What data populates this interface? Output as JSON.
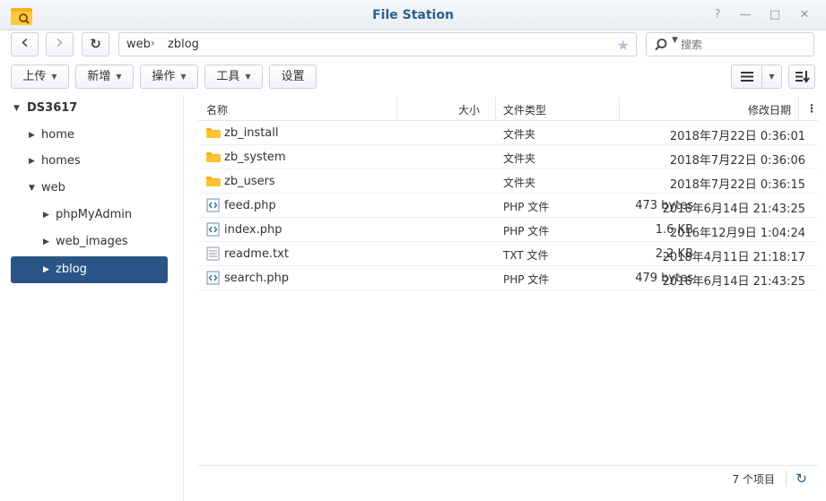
{
  "window": {
    "title": "File Station"
  },
  "titlebar_buttons": {
    "help": "?",
    "minimize": "—",
    "maximize": "□",
    "close": "✕"
  },
  "nav": {
    "back": "‹",
    "forward": "›",
    "refresh": "↻"
  },
  "path": {
    "segments": [
      "web",
      "zblog"
    ],
    "separator": "›"
  },
  "search": {
    "placeholder": "搜索",
    "value": ""
  },
  "toolbar": {
    "upload": "上传",
    "create": "新增",
    "action": "操作",
    "tools": "工具",
    "settings": "设置"
  },
  "tree": {
    "root": "DS3617",
    "items": [
      {
        "label": "home"
      },
      {
        "label": "homes"
      },
      {
        "label": "web"
      },
      {
        "label": "phpMyAdmin"
      },
      {
        "label": "web_images"
      },
      {
        "label": "zblog"
      }
    ]
  },
  "columns": {
    "name": "名称",
    "size": "大小",
    "type": "文件类型",
    "modified": "修改日期"
  },
  "files": [
    {
      "name": "zb_install",
      "size": "",
      "type": "文件夹",
      "modified": "2018年7月22日 0:36:01",
      "icon": "folder-icon"
    },
    {
      "name": "zb_system",
      "size": "",
      "type": "文件夹",
      "modified": "2018年7月22日 0:36:06",
      "icon": "folder-icon"
    },
    {
      "name": "zb_users",
      "size": "",
      "type": "文件夹",
      "modified": "2018年7月22日 0:36:15",
      "icon": "folder-icon"
    },
    {
      "name": "feed.php",
      "size": "473 bytes",
      "type": "PHP 文件",
      "modified": "2016年6月14日 21:43:25",
      "icon": "code-file-icon"
    },
    {
      "name": "index.php",
      "size": "1.6 KB",
      "type": "PHP 文件",
      "modified": "2016年12月9日 1:04:24",
      "icon": "code-file-icon"
    },
    {
      "name": "readme.txt",
      "size": "2.2 KB",
      "type": "TXT 文件",
      "modified": "2018年4月11日 21:18:17",
      "icon": "text-file-icon"
    },
    {
      "name": "search.php",
      "size": "479 bytes",
      "type": "PHP 文件",
      "modified": "2016年6月14日 21:43:25",
      "icon": "code-file-icon"
    }
  ],
  "status": {
    "count": "7 个项目"
  },
  "colors": {
    "accent": "#2a5587",
    "title": "#2c5f8f",
    "folder": "#f5b01d"
  }
}
